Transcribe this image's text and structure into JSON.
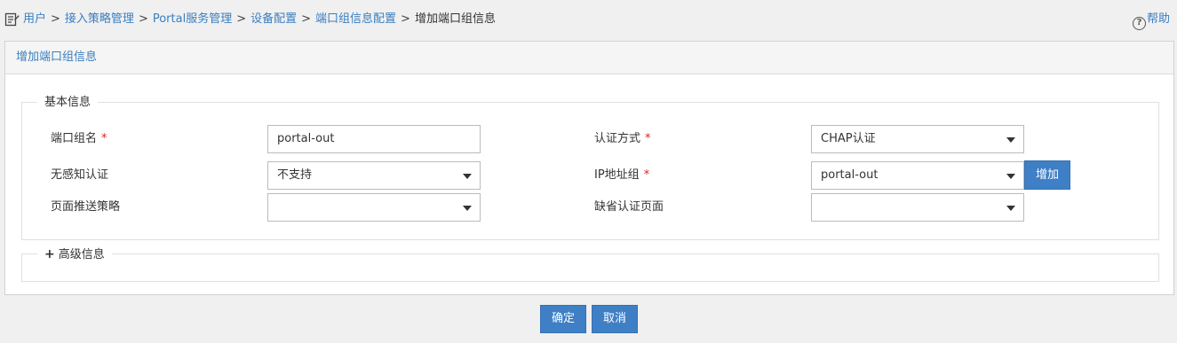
{
  "breadcrumb": {
    "items": [
      "用户",
      "接入策略管理",
      "Portal服务管理",
      "设备配置",
      "端口组信息配置"
    ],
    "current": "增加端口组信息",
    "separator": ">"
  },
  "help": {
    "icon": "?",
    "label": "帮助"
  },
  "panel": {
    "title": "增加端口组信息"
  },
  "basic_info": {
    "legend": "基本信息",
    "port_group_name": {
      "label": "端口组名",
      "required_mark": "*",
      "value": "portal-out"
    },
    "auth_method": {
      "label": "认证方式",
      "required_mark": "*",
      "value": "CHAP认证"
    },
    "seamless_auth": {
      "label": "无感知认证",
      "value": "不支持"
    },
    "ip_group": {
      "label": "IP地址组",
      "required_mark": "*",
      "value": "portal-out",
      "add_label": "增加"
    },
    "page_push_policy": {
      "label": "页面推送策略",
      "value": ""
    },
    "default_auth_page": {
      "label": "缺省认证页面",
      "value": ""
    }
  },
  "advanced_info": {
    "legend": "高级信息",
    "expand_icon": "+"
  },
  "actions": {
    "ok_label": "确定",
    "cancel_label": "取消"
  },
  "colors": {
    "accent": "#3e7fc5",
    "link": "#3a7ec0",
    "required": "#d9251c"
  }
}
